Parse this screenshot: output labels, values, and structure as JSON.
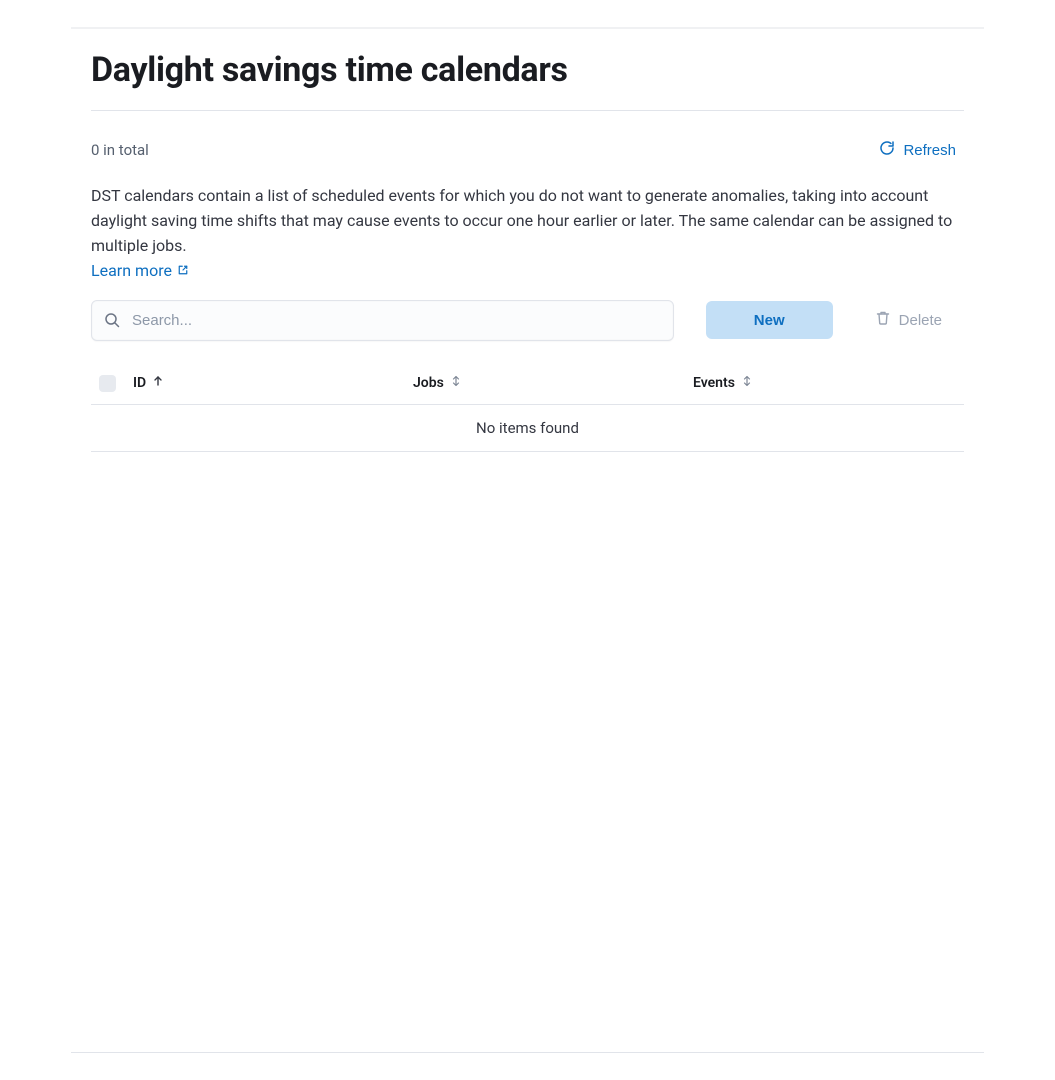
{
  "page": {
    "title": "Daylight savings time calendars",
    "total_label": "0 in total",
    "refresh_label": "Refresh",
    "description": "DST calendars contain a list of scheduled events for which you do not want to generate anomalies, taking into account daylight saving time shifts that may cause events to occur one hour earlier or later. The same calendar can be assigned to multiple jobs.",
    "learn_more_label": "Learn more"
  },
  "toolbar": {
    "search_placeholder": "Search...",
    "search_value": "",
    "new_label": "New",
    "delete_label": "Delete"
  },
  "table": {
    "columns": {
      "id": "ID",
      "jobs": "Jobs",
      "events": "Events"
    },
    "empty_message": "No items found",
    "rows": []
  }
}
